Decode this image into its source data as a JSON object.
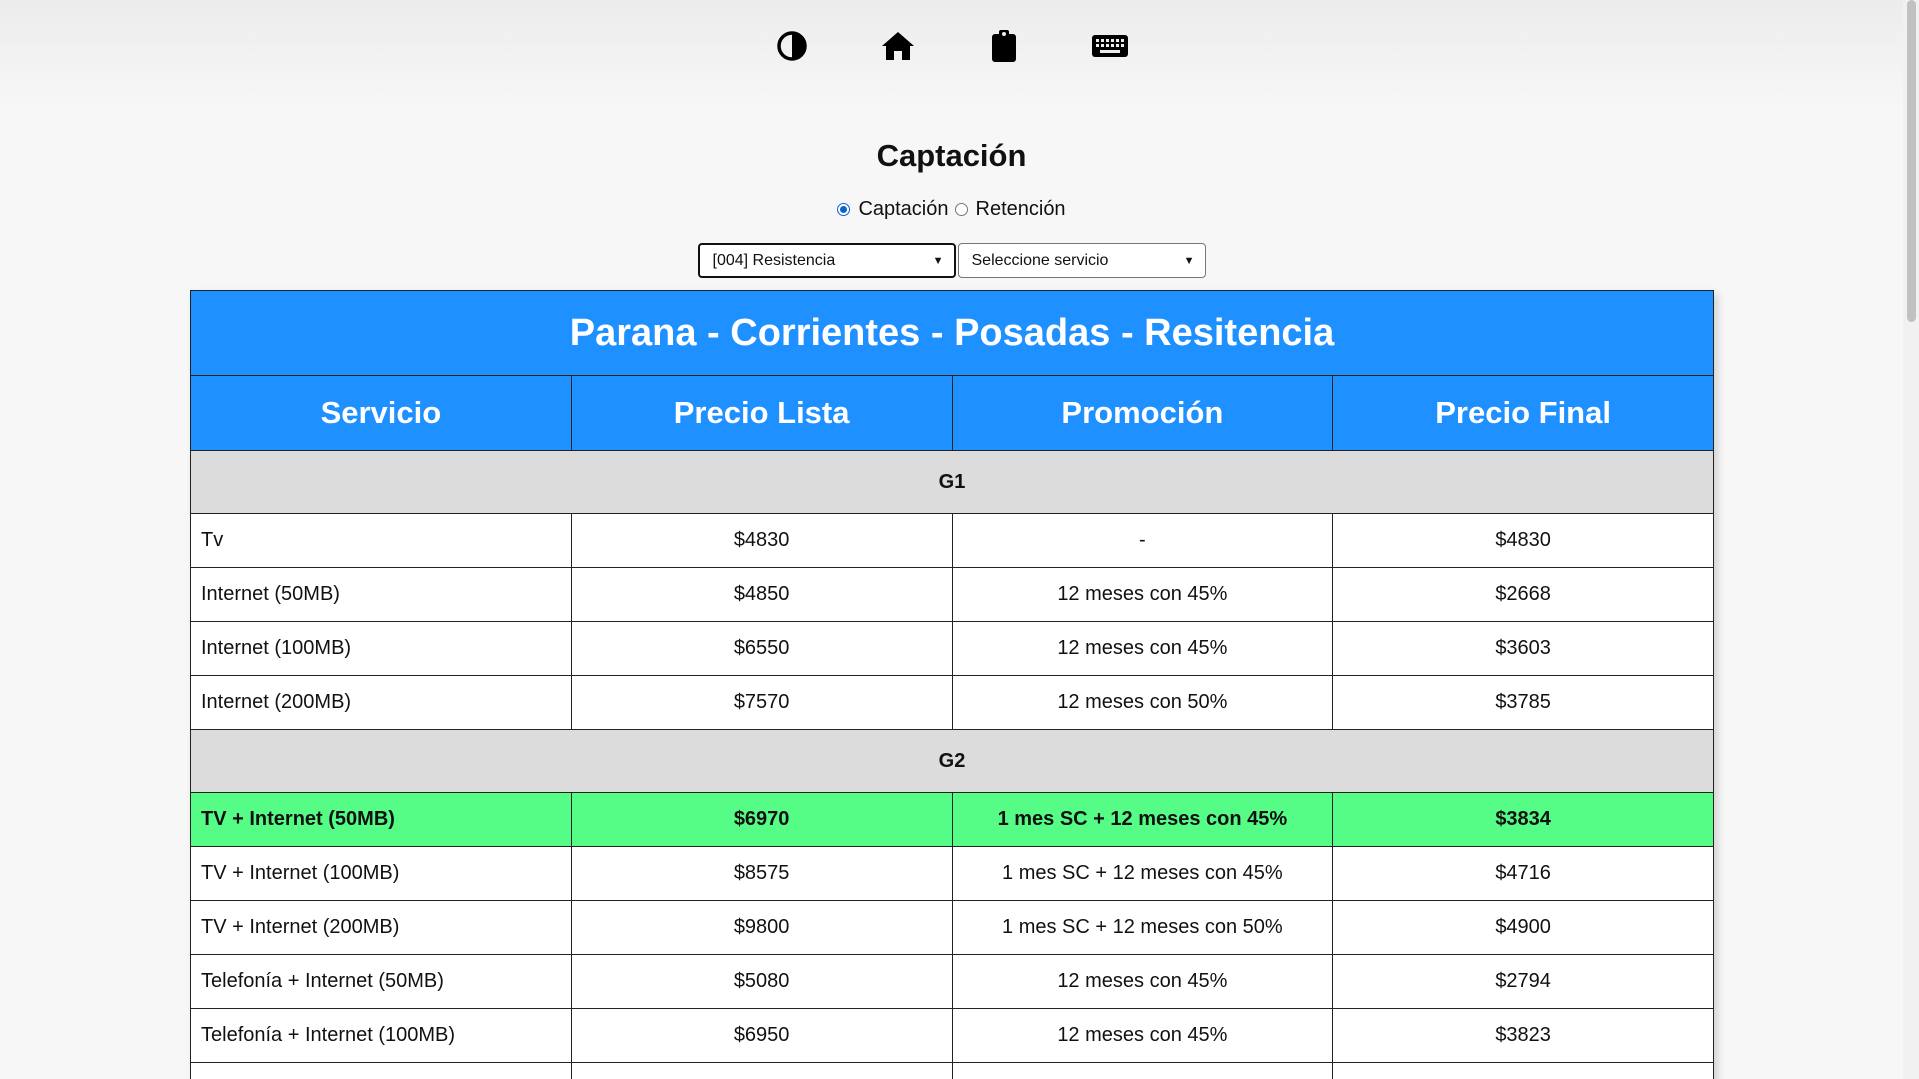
{
  "toolbar": {
    "icons": [
      "contrast-icon",
      "home-icon",
      "clipboard-icon",
      "keyboard-icon"
    ]
  },
  "title": "Captación",
  "mode": {
    "options": [
      {
        "label": "Captación",
        "checked": true
      },
      {
        "label": "Retención",
        "checked": false
      }
    ]
  },
  "filters": {
    "branch_selected": "[004] Resistencia",
    "service_selected": "Seleccione servicio"
  },
  "table": {
    "banner": "Parana - Corrientes - Posadas - Resitencia",
    "headers": [
      "Servicio",
      "Precio Lista",
      "Promoción",
      "Precio Final"
    ],
    "groups": [
      {
        "name": "G1",
        "rows": [
          {
            "service": "Tv",
            "list_price": "$4830",
            "promo": "-",
            "final_price": "$4830",
            "highlight": false
          },
          {
            "service": "Internet (50MB)",
            "list_price": "$4850",
            "promo": "12 meses con 45%",
            "final_price": "$2668",
            "highlight": false
          },
          {
            "service": "Internet (100MB)",
            "list_price": "$6550",
            "promo": "12 meses con 45%",
            "final_price": "$3603",
            "highlight": false
          },
          {
            "service": "Internet (200MB)",
            "list_price": "$7570",
            "promo": "12 meses con 50%",
            "final_price": "$3785",
            "highlight": false
          }
        ]
      },
      {
        "name": "G2",
        "rows": [
          {
            "service": "TV + Internet (50MB)",
            "list_price": "$6970",
            "promo": "1 mes SC + 12 meses con 45%",
            "final_price": "$3834",
            "highlight": true
          },
          {
            "service": "TV + Internet (100MB)",
            "list_price": "$8575",
            "promo": "1 mes SC + 12 meses con 45%",
            "final_price": "$4716",
            "highlight": false
          },
          {
            "service": "TV + Internet (200MB)",
            "list_price": "$9800",
            "promo": "1 mes SC + 12 meses con 50%",
            "final_price": "$4900",
            "highlight": false
          },
          {
            "service": "Telefonía + Internet (50MB)",
            "list_price": "$5080",
            "promo": "12 meses con 45%",
            "final_price": "$2794",
            "highlight": false
          },
          {
            "service": "Telefonía + Internet (100MB)",
            "list_price": "$6950",
            "promo": "12 meses con 45%",
            "final_price": "$3823",
            "highlight": false
          }
        ]
      }
    ]
  },
  "colors": {
    "header_bg": "#1e90ff",
    "group_bg": "#dcdcdc",
    "highlight_bg": "#55fc85"
  }
}
